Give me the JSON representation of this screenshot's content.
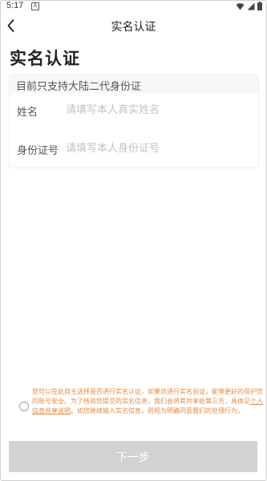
{
  "status_bar": {
    "time": "5:17",
    "notification_letter": "A",
    "icons": [
      "wifi-icon",
      "signal-icon",
      "battery-icon"
    ]
  },
  "nav": {
    "back_icon": "back-chevron-icon",
    "title": "实名认证"
  },
  "page": {
    "title": "实名认证"
  },
  "form": {
    "note": "目前只支持大陆二代身份证",
    "name_label": "姓名",
    "name_placeholder": "请填写本人真实姓名",
    "name_value": "",
    "id_label": "身份证号",
    "id_placeholder": "请填写本人身份证号",
    "id_value": ""
  },
  "consent": {
    "checked": false,
    "text_before_link": "您可以在此自主选择是否进行实名认证，如果您进行实名验证，能够更好的保护您的账号安全。为了核验您提交的实名信息，我们会将其共享给第三方，具体见",
    "link_text": "个人信息共享说明",
    "text_after_link": "。如您继续输入实名信息，则视为明确同意我们的处理行为。"
  },
  "actions": {
    "next_label": "下一步"
  },
  "colors": {
    "consent_text": "#e8883a",
    "button_disabled": "#d2d2d2",
    "placeholder": "#c2c2c2"
  }
}
